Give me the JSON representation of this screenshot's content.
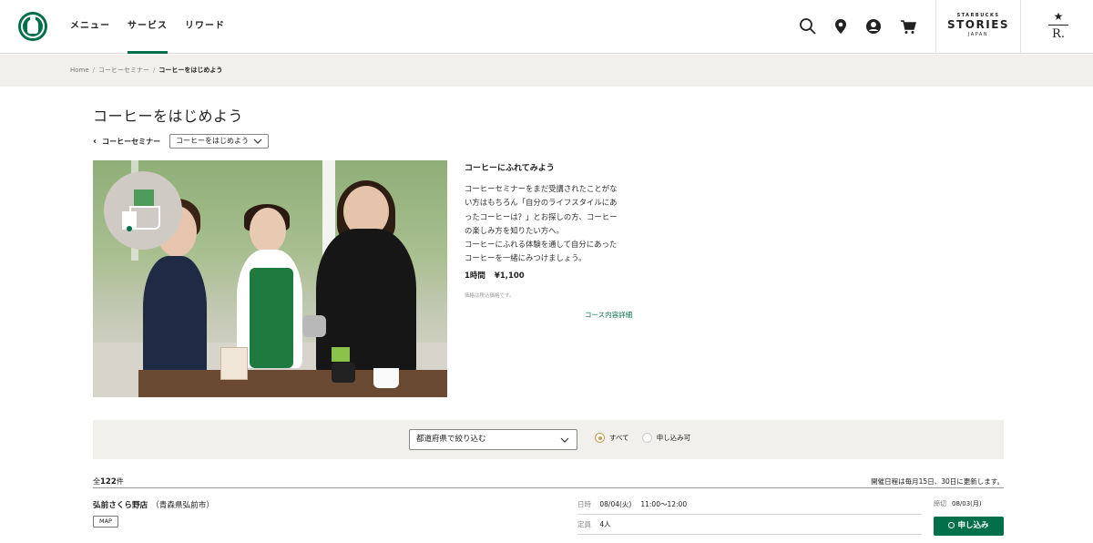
{
  "header": {
    "nav": [
      {
        "label": "メニュー",
        "active": false
      },
      {
        "label": "サービス",
        "active": true
      },
      {
        "label": "リワード",
        "active": false
      }
    ],
    "icons": [
      "search-icon",
      "location-pin-icon",
      "account-icon",
      "cart-icon"
    ],
    "stories": {
      "top": "STARBUCKS",
      "main": "STORIES",
      "bottom": "JAPAN"
    },
    "reserve": {
      "star": "★",
      "letter": "R."
    }
  },
  "breadcrumb": {
    "home": "Home",
    "parent": "コーヒーセミナー",
    "current": "コーヒーをはじめよう",
    "separator": "/"
  },
  "page": {
    "title": "コーヒーをはじめよう",
    "back_label": "コーヒーセミナー",
    "course_select_value": "コーヒーをはじめよう"
  },
  "description": {
    "heading": "コーヒーにふれてみよう",
    "body": "コーヒーセミナーをまだ受講されたことがな\nい方はもちろん「自分のライフスタイルにあ\nったコーヒーは？」とお探しの方、コーヒー\nの楽しみ方を知りたい方へ。\nコーヒーにふれる体験を通して自分にあった\nコーヒーを一緒にみつけましょう。",
    "duration": "1時間",
    "price": "¥1,100",
    "tax_note": "価格は税込価格です。",
    "detail_link": "コース内容詳細"
  },
  "filter": {
    "prefecture_placeholder": "都道府県で絞り込む",
    "radio": [
      {
        "label": "すべて",
        "checked": true
      },
      {
        "label": "申し込み可",
        "checked": false
      }
    ]
  },
  "results": {
    "count_prefix": "全",
    "count": "122",
    "count_suffix": "件",
    "update_note": "開催日程は毎月15日、30日に更新します。",
    "items": [
      {
        "store": "弘前さくら野店",
        "prefecture": "（青森県弘前市）",
        "map_label": "MAP",
        "date_key": "日時",
        "date_value": "08/04(火)",
        "time_value": "11:00〜12:00",
        "capacity_key": "定員",
        "capacity_value": "4人",
        "deadline_key": "締切",
        "deadline_value": "08/03(月)",
        "apply_label": "申し込み"
      }
    ]
  },
  "colors": {
    "brand_green": "#00704a",
    "band_bg": "#f1f0ed",
    "radio_gold": "#c59b52"
  }
}
